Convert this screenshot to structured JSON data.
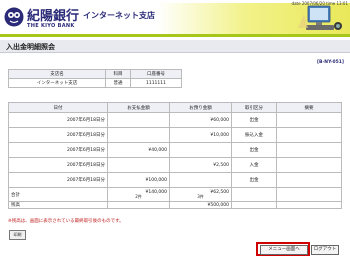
{
  "header": {
    "datetime": "date 2007/06/20 time 13:01",
    "bank_name": "紀陽銀行",
    "branch_name": "インターネット支店",
    "bank_en": "THE KIYO BANK",
    "accent_color": "#a6c61a"
  },
  "page": {
    "title": "入出金明細照会",
    "code": "[B-NY-051]"
  },
  "account": {
    "headers": [
      "支店名",
      "科目",
      "口座番号"
    ],
    "row": [
      "インターネット支店",
      "普通",
      "1111111"
    ]
  },
  "transactions": {
    "headers": [
      "日付",
      "お支払金額",
      "お預り金額",
      "取引区分",
      "摘要"
    ],
    "rows": [
      {
        "date": "2007年6月18日分",
        "withdrawal": "",
        "deposit": "¥60,000",
        "type": "出金",
        "memo": ""
      },
      {
        "date": "2007年6月18日分",
        "withdrawal": "",
        "deposit": "¥10,000",
        "type": "振込入金",
        "memo": ""
      },
      {
        "date": "2007年6月18日分",
        "withdrawal": "¥40,000",
        "deposit": "",
        "type": "出金",
        "memo": ""
      },
      {
        "date": "2007年6月18日分",
        "withdrawal": "",
        "deposit": "¥2,500",
        "type": "入金",
        "memo": ""
      },
      {
        "date": "2007年6月18日分",
        "withdrawal": "¥100,000",
        "deposit": "",
        "type": "出金",
        "memo": ""
      }
    ],
    "total": {
      "label": "合計",
      "withdrawal": "¥140,000",
      "withdrawal_count": "2件",
      "deposit": "¥62,500",
      "deposit_count": "3件"
    },
    "balance": {
      "label": "残高",
      "value": "¥500,000"
    }
  },
  "note": "※残高は、画面に表示されている最終取引後のものです。",
  "buttons": {
    "print": "印刷",
    "menu": "メニュー画面へ",
    "logout": "ログアウト"
  }
}
